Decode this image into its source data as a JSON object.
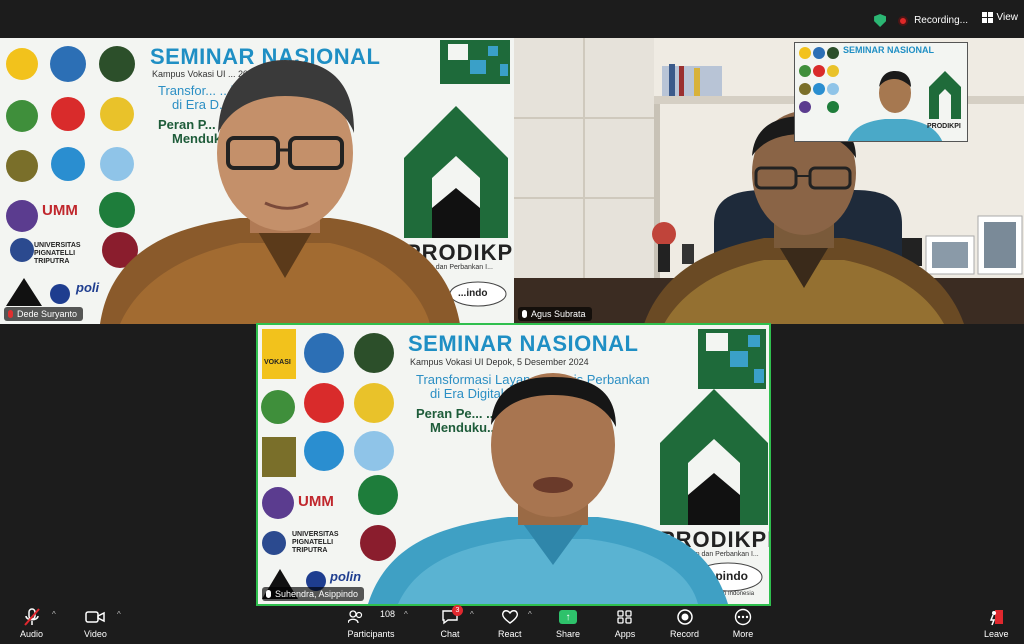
{
  "topbar": {
    "recording_label": "Recording...",
    "view_label": "View"
  },
  "tiles": [
    {
      "name": "Dede Suryanto",
      "slide": {
        "title": "SEMINAR NASIONAL",
        "subtitle": "Kampus Vokasi UI ... 2024",
        "bullet1_line1": "Transfor... ...isnis Perbankan",
        "bullet1_line2": "di Era D...",
        "bullet2_line1": "Peran P... ...minan dalam",
        "bullet2_line2": "Menduk... ...bankan",
        "brand": "PRODIKPI",
        "brand_sub": "...Keuangan dan Perbankan I...",
        "logo_text": "UMM",
        "univ_text": "UNIVERSITAS PIGNATELLI TRIPUTRA",
        "poli_text": "poli",
        "askrindo": "...indo"
      }
    },
    {
      "name": "Agus Subrata"
    },
    {
      "name": "Suhendra, Asippindo",
      "slide": {
        "title": "SEMINAR NASIONAL",
        "subtitle": "Kampus Vokasi UI Depok, 5 Desember 2024",
        "bullet1_line1": "Transformasi Layanan Bisnis Perbankan",
        "bullet1_line2": "di Era Digital",
        "bullet2_line1": "Peran Pe... ...minan dalam",
        "bullet2_line2": "Menduku... ...bankan",
        "brand": "PRODIKPI",
        "brand_sub": "...n Keuangan dan Perbankan I...",
        "logo_text": "UMM",
        "univ_text": "UNIVERSITAS PIGNATELLI TRIPUTRA",
        "poli_text": "polin",
        "askrindo": "sippindo",
        "askrindo_sub": "...nan Penjaminan Indonesia",
        "vokasi": "VOKASI"
      }
    }
  ],
  "self_view": {
    "title": "SEMINAR NASIONAL",
    "brand": "PRODIKPI"
  },
  "toolbar": {
    "audio": "Audio",
    "video": "Video",
    "participants": "Participants",
    "participants_count": "108",
    "chat": "Chat",
    "chat_badge": "3",
    "react": "React",
    "share": "Share",
    "apps": "Apps",
    "record": "Record",
    "more": "More",
    "leave": "Leave"
  },
  "colors": {
    "active_speaker_border": "#2fbf4e",
    "share_green": "#2ec26b",
    "leave_red": "#e0282e",
    "seminar_blue": "#1f8fc4",
    "prodikpi_green": "#1f6b3a"
  }
}
